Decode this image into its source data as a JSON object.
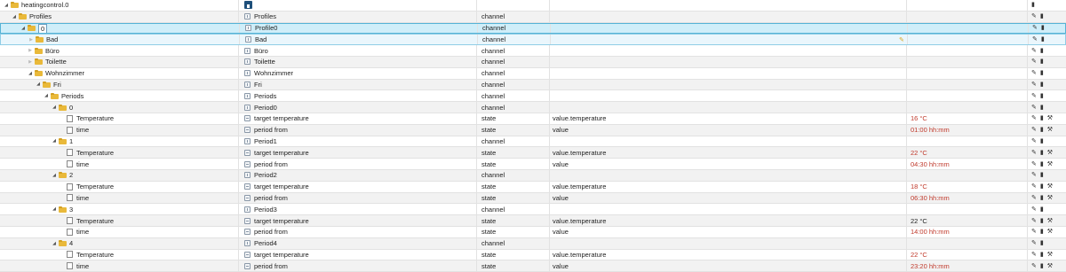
{
  "rows": [
    {
      "id": "heatingcontrol.0",
      "level": 0,
      "toggle": "expanded",
      "icon": "folder",
      "name": "",
      "name_icon": "home",
      "type": "",
      "role": "",
      "value": "",
      "value_color": "",
      "actions": [
        "delete"
      ]
    },
    {
      "id": "Profiles",
      "level": 1,
      "toggle": "expanded",
      "icon": "folder",
      "name": "Profiles",
      "name_icon": "channel",
      "type": "channel",
      "role": "",
      "value": "",
      "value_color": "",
      "actions": [
        "edit",
        "delete"
      ]
    },
    {
      "id": "0",
      "level": 2,
      "toggle": "expanded",
      "icon": "folder",
      "name": "Profile0",
      "name_icon": "channel",
      "type": "channel",
      "role": "",
      "value": "",
      "value_color": "",
      "actions": [
        "edit",
        "delete"
      ],
      "state": "selected"
    },
    {
      "id": "Bad",
      "level": 3,
      "toggle": "collapsed",
      "icon": "folder",
      "name": "Bad",
      "name_icon": "channel",
      "type": "channel",
      "role": "",
      "value": "",
      "value_color": "",
      "actions": [
        "edit",
        "delete"
      ],
      "state": "hovered"
    },
    {
      "id": "Büro",
      "level": 3,
      "toggle": "collapsed",
      "icon": "folder",
      "name": "Büro",
      "name_icon": "channel",
      "type": "channel",
      "role": "",
      "value": "",
      "value_color": "",
      "actions": [
        "edit",
        "delete"
      ]
    },
    {
      "id": "Toilette",
      "level": 3,
      "toggle": "collapsed",
      "icon": "folder",
      "name": "Toilette",
      "name_icon": "channel",
      "type": "channel",
      "role": "",
      "value": "",
      "value_color": "",
      "actions": [
        "edit",
        "delete"
      ]
    },
    {
      "id": "Wohnzimmer",
      "level": 3,
      "toggle": "expanded",
      "icon": "folder",
      "name": "Wohnzimmer",
      "name_icon": "channel",
      "type": "channel",
      "role": "",
      "value": "",
      "value_color": "",
      "actions": [
        "edit",
        "delete"
      ]
    },
    {
      "id": "Fri",
      "level": 4,
      "toggle": "expanded",
      "icon": "folder",
      "name": "Fri",
      "name_icon": "channel",
      "type": "channel",
      "role": "",
      "value": "",
      "value_color": "",
      "actions": [
        "edit",
        "delete"
      ]
    },
    {
      "id": "Periods",
      "level": 5,
      "toggle": "expanded",
      "icon": "folder",
      "name": "Periods",
      "name_icon": "channel",
      "type": "channel",
      "role": "",
      "value": "",
      "value_color": "",
      "actions": [
        "edit",
        "delete"
      ]
    },
    {
      "id": "0",
      "level": 6,
      "toggle": "expanded",
      "icon": "folder",
      "name": "Period0",
      "name_icon": "channel",
      "type": "channel",
      "role": "",
      "value": "",
      "value_color": "",
      "actions": [
        "edit",
        "delete"
      ]
    },
    {
      "id": "Temperature",
      "level": 7,
      "toggle": "none",
      "icon": "file",
      "name": "target temperature",
      "name_icon": "state",
      "type": "state",
      "role": "value.temperature",
      "value": "16 °C",
      "value_color": "red",
      "actions": [
        "edit",
        "delete",
        "wrench"
      ]
    },
    {
      "id": "time",
      "level": 7,
      "toggle": "none",
      "icon": "file",
      "name": "period from",
      "name_icon": "state",
      "type": "state",
      "role": "value",
      "value": "01:00 hh:mm",
      "value_color": "red",
      "actions": [
        "edit",
        "delete",
        "wrench"
      ]
    },
    {
      "id": "1",
      "level": 6,
      "toggle": "expanded",
      "icon": "folder",
      "name": "Period1",
      "name_icon": "channel",
      "type": "channel",
      "role": "",
      "value": "",
      "value_color": "",
      "actions": [
        "edit",
        "delete"
      ]
    },
    {
      "id": "Temperature",
      "level": 7,
      "toggle": "none",
      "icon": "file",
      "name": "target temperature",
      "name_icon": "state",
      "type": "state",
      "role": "value.temperature",
      "value": "22 °C",
      "value_color": "red",
      "actions": [
        "edit",
        "delete",
        "wrench"
      ]
    },
    {
      "id": "time",
      "level": 7,
      "toggle": "none",
      "icon": "file",
      "name": "period from",
      "name_icon": "state",
      "type": "state",
      "role": "value",
      "value": "04:30 hh:mm",
      "value_color": "red",
      "actions": [
        "edit",
        "delete",
        "wrench"
      ]
    },
    {
      "id": "2",
      "level": 6,
      "toggle": "expanded",
      "icon": "folder",
      "name": "Period2",
      "name_icon": "channel",
      "type": "channel",
      "role": "",
      "value": "",
      "value_color": "",
      "actions": [
        "edit",
        "delete"
      ]
    },
    {
      "id": "Temperature",
      "level": 7,
      "toggle": "none",
      "icon": "file",
      "name": "target temperature",
      "name_icon": "state",
      "type": "state",
      "role": "value.temperature",
      "value": "18 °C",
      "value_color": "red",
      "actions": [
        "edit",
        "delete",
        "wrench"
      ]
    },
    {
      "id": "time",
      "level": 7,
      "toggle": "none",
      "icon": "file",
      "name": "period from",
      "name_icon": "state",
      "type": "state",
      "role": "value",
      "value": "06:30 hh:mm",
      "value_color": "red",
      "actions": [
        "edit",
        "delete",
        "wrench"
      ]
    },
    {
      "id": "3",
      "level": 6,
      "toggle": "expanded",
      "icon": "folder",
      "name": "Period3",
      "name_icon": "channel",
      "type": "channel",
      "role": "",
      "value": "",
      "value_color": "",
      "actions": [
        "edit",
        "delete"
      ]
    },
    {
      "id": "Temperature",
      "level": 7,
      "toggle": "none",
      "icon": "file",
      "name": "target temperature",
      "name_icon": "state",
      "type": "state",
      "role": "value.temperature",
      "value": "22 °C",
      "value_color": "dark",
      "actions": [
        "edit",
        "delete",
        "wrench"
      ]
    },
    {
      "id": "time",
      "level": 7,
      "toggle": "none",
      "icon": "file",
      "name": "period from",
      "name_icon": "state",
      "type": "state",
      "role": "value",
      "value": "14:00 hh:mm",
      "value_color": "red",
      "actions": [
        "edit",
        "delete",
        "wrench"
      ]
    },
    {
      "id": "4",
      "level": 6,
      "toggle": "expanded",
      "icon": "folder",
      "name": "Period4",
      "name_icon": "channel",
      "type": "channel",
      "role": "",
      "value": "",
      "value_color": "",
      "actions": [
        "edit",
        "delete"
      ]
    },
    {
      "id": "Temperature",
      "level": 7,
      "toggle": "none",
      "icon": "file",
      "name": "target temperature",
      "name_icon": "state",
      "type": "state",
      "role": "value.temperature",
      "value": "22 °C",
      "value_color": "red",
      "actions": [
        "edit",
        "delete",
        "wrench"
      ]
    },
    {
      "id": "time",
      "level": 7,
      "toggle": "none",
      "icon": "file",
      "name": "period from",
      "name_icon": "state",
      "type": "state",
      "role": "value",
      "value": "23:20 hh:mm",
      "value_color": "red",
      "actions": [
        "edit",
        "delete",
        "wrench"
      ]
    }
  ],
  "icons": {
    "edit": "pencil-icon",
    "delete": "trash-icon",
    "wrench": "wrench-icon",
    "expanded": "triangle-down-icon",
    "collapsed": "triangle-right-icon"
  },
  "colors": {
    "selected_row": "#cfeef9",
    "value_red": "#c0392b",
    "folder": "#e9b93a"
  }
}
